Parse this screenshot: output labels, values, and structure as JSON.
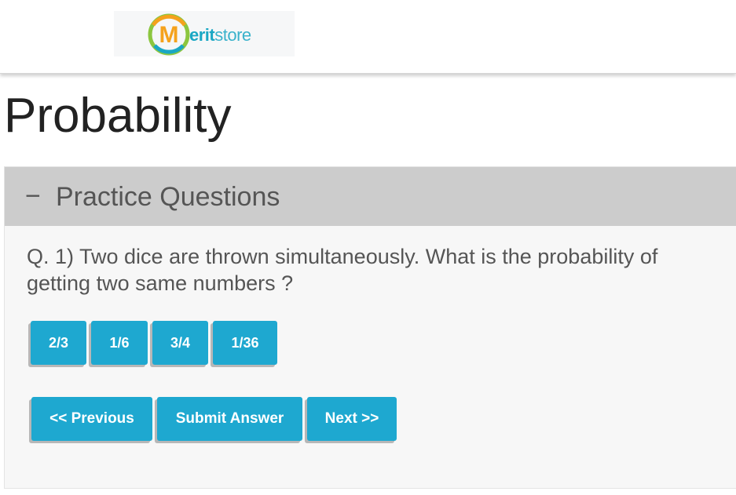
{
  "header": {
    "logo": {
      "text_bold": "erit",
      "text_light": "store",
      "mark_letter": "M"
    }
  },
  "page": {
    "title": "Probability"
  },
  "panel": {
    "collapse_symbol": "−",
    "title": "Practice Questions",
    "question": "Q. 1) Two dice are thrown simultaneously. What is the probability of getting two same numbers ?",
    "options": [
      "2/3",
      "1/6",
      "3/4",
      "1/36"
    ],
    "nav": {
      "previous": "<< Previous",
      "submit": "Submit Answer",
      "next": "Next >>"
    }
  },
  "colors": {
    "accent": "#1ea8d0",
    "panel_header": "#cccccc",
    "logo_orange": "#f5a21c",
    "logo_green": "#8cc63f"
  }
}
